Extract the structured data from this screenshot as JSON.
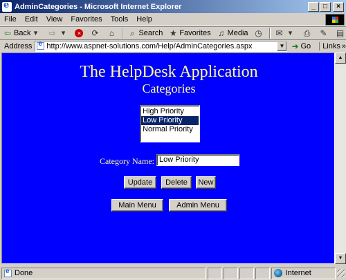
{
  "window": {
    "title": "AdminCategories - Microsoft Internet Explorer",
    "minimize": "_",
    "maximize": "□",
    "close": "×"
  },
  "menu": [
    "File",
    "Edit",
    "View",
    "Favorites",
    "Tools",
    "Help"
  ],
  "toolbar": {
    "back_label": "Back",
    "search_label": "Search",
    "favorites_label": "Favorites",
    "media_label": "Media"
  },
  "address": {
    "label": "Address",
    "url": "http://www.aspnet-solutions.com/Help/AdminCategories.aspx",
    "go_label": "Go",
    "links_label": "Links"
  },
  "page": {
    "title": "The HelpDesk Application",
    "subtitle": "Categories",
    "listbox_options": [
      "High Priority",
      "Low Priority",
      "Normal Priority"
    ],
    "selected_option": "Low Priority",
    "category_label": "Category Name:",
    "category_value": "Low Priority",
    "buttons": {
      "update": "Update",
      "delete": "Delete",
      "new": "New",
      "main_menu": "Main Menu",
      "admin_menu": "Admin Menu"
    }
  },
  "status": {
    "text": "Done",
    "zone": "Internet"
  },
  "colors": {
    "page_background": "#0000ff",
    "heading_text": "#ffff99",
    "selection": "#0a246a"
  }
}
